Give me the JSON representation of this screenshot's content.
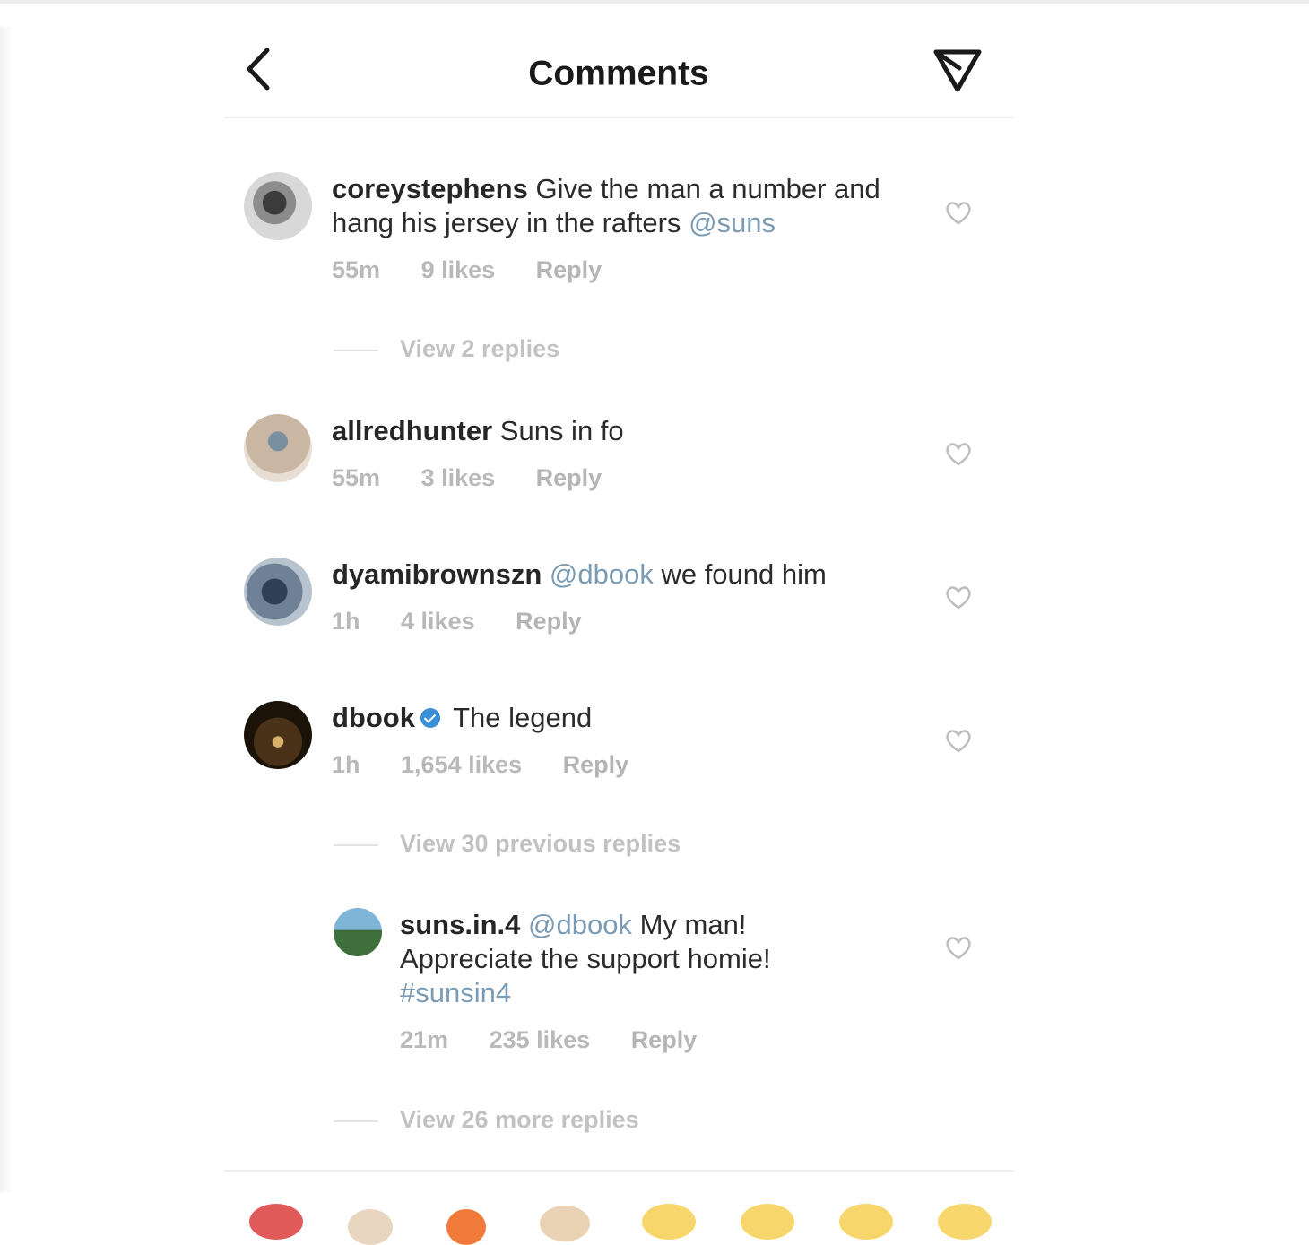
{
  "header": {
    "title": "Comments",
    "back_icon": "chevron-left-icon",
    "send_icon": "paper-plane-icon"
  },
  "colors": {
    "mention": "#7a9bb3",
    "verified": "#3a8fd6",
    "meta": "#b9b9b9"
  },
  "comments": [
    {
      "username": "coreystephens",
      "text": "Give the man a number and hang his jersey in the rafters",
      "mention_after": "@suns",
      "time": "55m",
      "likes": "9 likes",
      "reply_label": "Reply",
      "view_replies": "View 2 replies"
    },
    {
      "username": "allredhunter",
      "text": "Suns in fo",
      "time": "55m",
      "likes": "3 likes",
      "reply_label": "Reply"
    },
    {
      "username": "dyamibrownszn",
      "mention_before": "@dbook",
      "text": "we found him",
      "time": "1h",
      "likes": "4 likes",
      "reply_label": "Reply"
    },
    {
      "username": "dbook",
      "verified": true,
      "text": "The legend",
      "time": "1h",
      "likes": "1,654 likes",
      "reply_label": "Reply",
      "view_previous": "View 30 previous replies"
    }
  ],
  "reply": {
    "username": "suns.in.4",
    "mention_before": "@dbook",
    "text": "My man! Appreciate the support homie!",
    "hashtag": "#sunsin4",
    "time": "21m",
    "likes": "235 likes",
    "reply_label": "Reply",
    "view_more": "View 26 more replies"
  },
  "emoji_bar": [
    "heart-emoji",
    "raised-hands-emoji",
    "fire-emoji",
    "clapping-emoji",
    "crying-emoji",
    "smiling-emoji",
    "heart-eyes-emoji",
    "laughing-emoji"
  ]
}
